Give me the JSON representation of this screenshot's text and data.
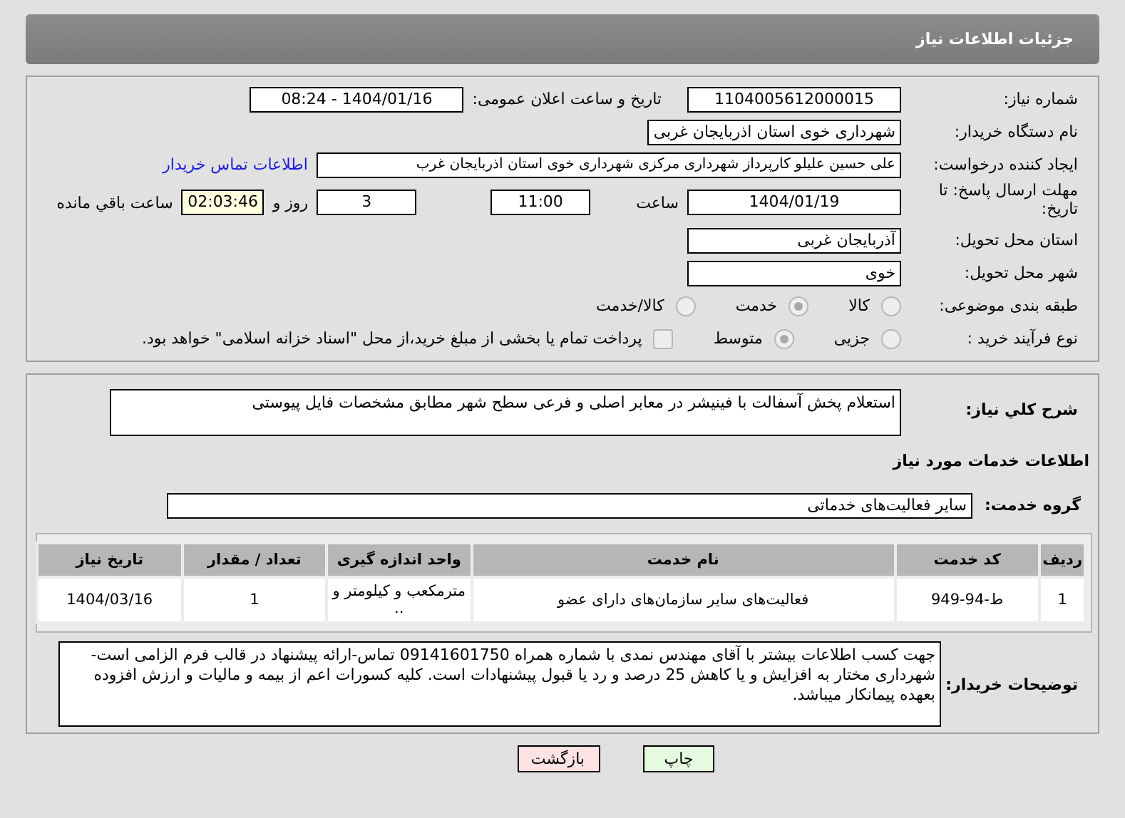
{
  "header": {
    "title": "جزئیات اطلاعات نیاز"
  },
  "need_number": {
    "label": "شماره نیاز:",
    "value": "1104005612000015"
  },
  "announce_date": {
    "label": "تاریخ و ساعت اعلان عمومی:",
    "value": "1404/01/16 - 08:24"
  },
  "buyer_org": {
    "label": "نام دستگاه خریدار:",
    "value": "شهرداری خوی استان اذربایجان غربی"
  },
  "requester": {
    "label": "ایجاد کننده درخواست:",
    "value": "علی حسین علیلو کارپرداز شهرداری مرکزی شهرداری خوی استان اذربایجان غرب",
    "link": "اطلاعات تماس خریدار"
  },
  "deadline": {
    "label": "مهلت ارسال پاسخ: تا تاریخ:",
    "date": "1404/01/19",
    "time_label": "ساعت",
    "time": "11:00",
    "days": "3",
    "days_label": "روز و",
    "remaining": "02:03:46",
    "remaining_label": "ساعت باقي مانده"
  },
  "province": {
    "label": "استان محل تحویل:",
    "value": "آذربایجان غربی"
  },
  "city": {
    "label": "شهر محل تحویل:",
    "value": "خوی"
  },
  "classification": {
    "label": "طبقه بندی موضوعی:",
    "options": [
      {
        "label": "کالا",
        "selected": false
      },
      {
        "label": "خدمت",
        "selected": true
      },
      {
        "label": "کالا/خدمت",
        "selected": false
      }
    ]
  },
  "purchase_type": {
    "label": "نوع فرآیند خرید :",
    "options": [
      {
        "label": "جزیی",
        "selected": false
      },
      {
        "label": "متوسط",
        "selected": true
      }
    ],
    "treasury": {
      "checked": false,
      "label": "پرداخت تمام یا بخشی از مبلغ خرید،از محل \"اسناد خزانه اسلامی\" خواهد بود."
    }
  },
  "description": {
    "label": "شرح کلي نياز:",
    "value": "استعلام پخش آسفالت با فینیشر در معابر اصلی و فرعی سطح شهر مطابق مشخصات فایل پیوستی"
  },
  "services_heading": "اطلاعات خدمات مورد نیاز",
  "service_group": {
    "label": "گروه خدمت:",
    "value": "سایر فعالیت‌های خدماتی"
  },
  "table": {
    "columns": [
      "ردیف",
      "کد خدمت",
      "نام خدمت",
      "واحد اندازه گیری",
      "تعداد / مقدار",
      "تاریخ نیاز"
    ],
    "rows": [
      [
        "1",
        "ط-94-949",
        "فعالیت‌های سایر سازمان‌های دارای عضو",
        "مترمکعب و کیلومتر و ..",
        "1",
        "1404/03/16"
      ]
    ]
  },
  "buyer_notes": {
    "label": "توضیحات خریدار:",
    "value": "جهت کسب اطلاعات بیشتر با آقای مهندس نمدی با شماره همراه 09141601750 تماس-ارائه پیشنهاد در قالب فرم الزامی است-شهرداری مختار به افزایش و یا کاهش 25 درصد و رد یا قبول پیشنهادات است. کلیه کسورات اعم از بیمه و مالیات و ارزش افزوده بعهده پیمانکار میباشد."
  },
  "buttons": [
    {
      "label": "چاپ",
      "kind": "print"
    },
    {
      "label": "بازگشت",
      "kind": "back"
    }
  ]
}
